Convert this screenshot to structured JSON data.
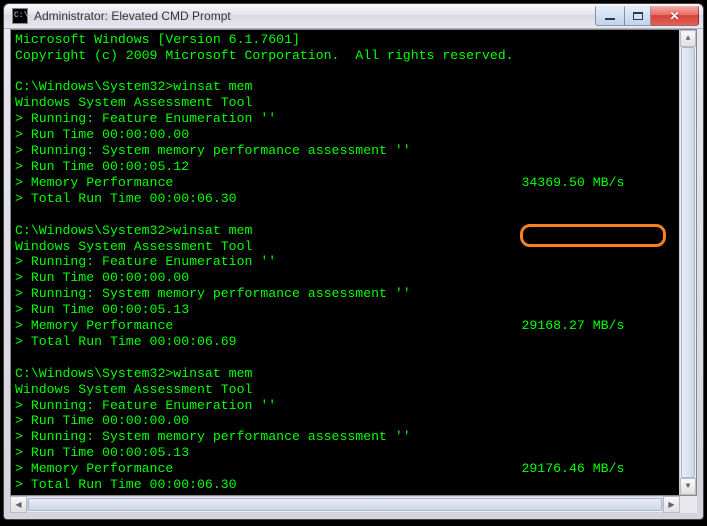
{
  "window": {
    "title": "Administrator: Elevated CMD Prompt",
    "icon_label": "cmd-icon"
  },
  "controls": {
    "minimize": "Minimize",
    "maximize": "Maximize",
    "close": "Close"
  },
  "terminal": {
    "header_line1": "Microsoft Windows [Version 6.1.7601]",
    "header_line2": "Copyright (c) 2009 Microsoft Corporation.  All rights reserved.",
    "prompt_path": "C:\\Windows\\System32>",
    "command": "winsat mem",
    "tool_name": "Windows System Assessment Tool",
    "runs": [
      {
        "feature_line": "> Running: Feature Enumeration ''",
        "run_time1": "> Run Time 00:00:00.00",
        "mem_line": "> Running: System memory performance assessment ''",
        "run_time2": "> Run Time 00:00:05.12",
        "mem_perf_label": "> Memory Performance",
        "mem_perf_value": "34369.50 MB/s",
        "total_time": "> Total Run Time 00:00:06.30"
      },
      {
        "feature_line": "> Running: Feature Enumeration ''",
        "run_time1": "> Run Time 00:00:00.00",
        "mem_line": "> Running: System memory performance assessment ''",
        "run_time2": "> Run Time 00:00:05.13",
        "mem_perf_label": "> Memory Performance",
        "mem_perf_value": "29168.27 MB/s",
        "total_time": "> Total Run Time 00:00:06.69"
      },
      {
        "feature_line": "> Running: Feature Enumeration ''",
        "run_time1": "> Run Time 00:00:00.00",
        "mem_line": "> Running: System memory performance assessment ''",
        "run_time2": "> Run Time 00:00:05.13",
        "mem_perf_label": "> Memory Performance",
        "mem_perf_value": "29176.46 MB/s",
        "total_time": "> Total Run Time 00:00:06.30"
      }
    ]
  },
  "highlight": {
    "description": "Orange rounded rectangle highlighting first Memory Performance value",
    "color": "#f58220"
  }
}
